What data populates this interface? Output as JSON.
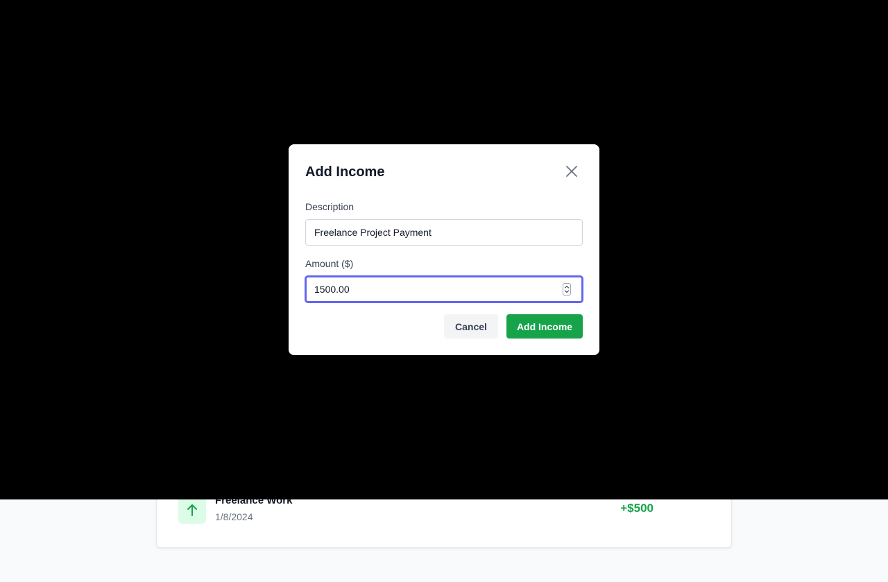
{
  "modal": {
    "title": "Add Income",
    "description_label": "Description",
    "description_value": "Freelance Project Payment",
    "amount_label": "Amount ($)",
    "amount_value": "1500.00",
    "cancel_label": "Cancel",
    "submit_label": "Add Income"
  },
  "transactions": [
    {
      "title": "Freelance Work",
      "date": "1/8/2024",
      "amount": "+$500",
      "icon": "arrow-up-icon"
    }
  ],
  "colors": {
    "accent": "#6366f1",
    "income": "#16a34a",
    "income_bg": "#dcfce7",
    "overlay": "#000000"
  }
}
